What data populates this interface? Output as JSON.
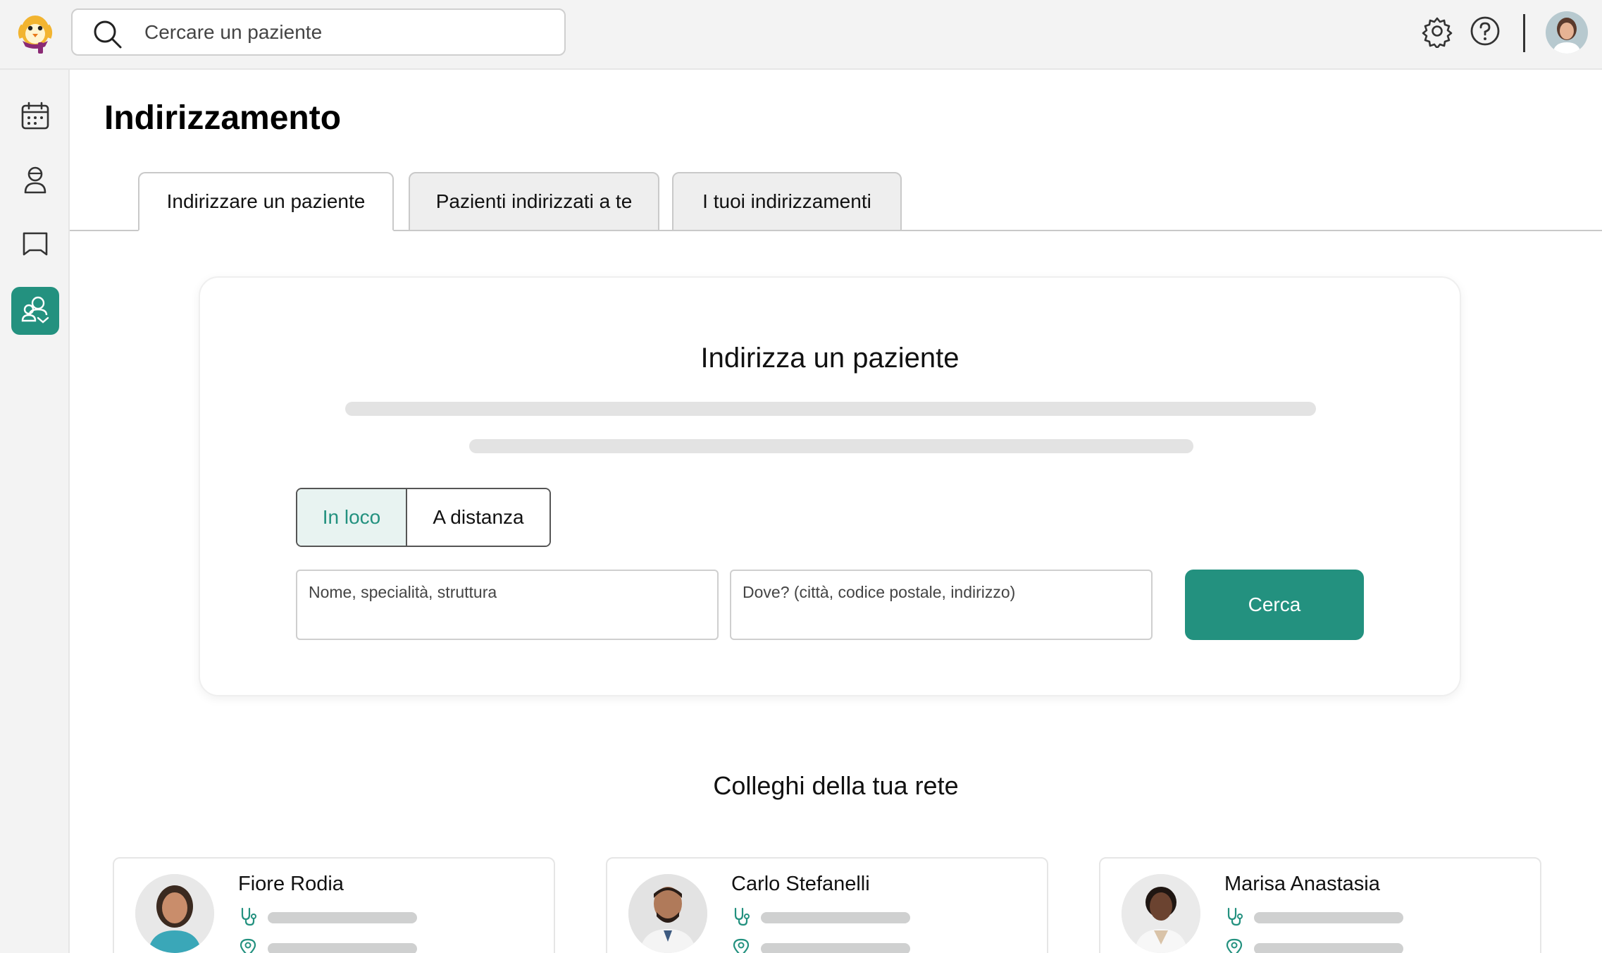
{
  "search": {
    "placeholder": "Cercare un paziente"
  },
  "page": {
    "title": "Indirizzamento"
  },
  "tabs": [
    {
      "label": "Indirizzare un paziente",
      "active": true
    },
    {
      "label": "Pazienti indirizzati a te",
      "active": false
    },
    {
      "label": "I tuoi indirizzamenti",
      "active": false
    }
  ],
  "referral_card": {
    "title": "Indirizza un paziente",
    "mode_options": [
      "In loco",
      "A distanza"
    ],
    "selected_mode": "In loco",
    "name_placeholder": "Nome, specialità, struttura",
    "where_placeholder": "Dove? (città, codice postale, indirizzo)",
    "search_button": "Cerca"
  },
  "network": {
    "title": "Colleghi della tua rete",
    "colleagues": [
      {
        "name": "Fiore Rodia"
      },
      {
        "name": "Carlo Stefanelli"
      },
      {
        "name": "Marisa Anastasia"
      }
    ]
  },
  "icons": {
    "sidebar": [
      "calendar-icon",
      "patient-icon",
      "messages-icon",
      "referral-icon"
    ],
    "top": [
      "settings-icon",
      "help-icon"
    ]
  },
  "colors": {
    "accent": "#23917f",
    "accent_light": "#e8f3f1",
    "topbar_bg": "#f3f3f3"
  }
}
